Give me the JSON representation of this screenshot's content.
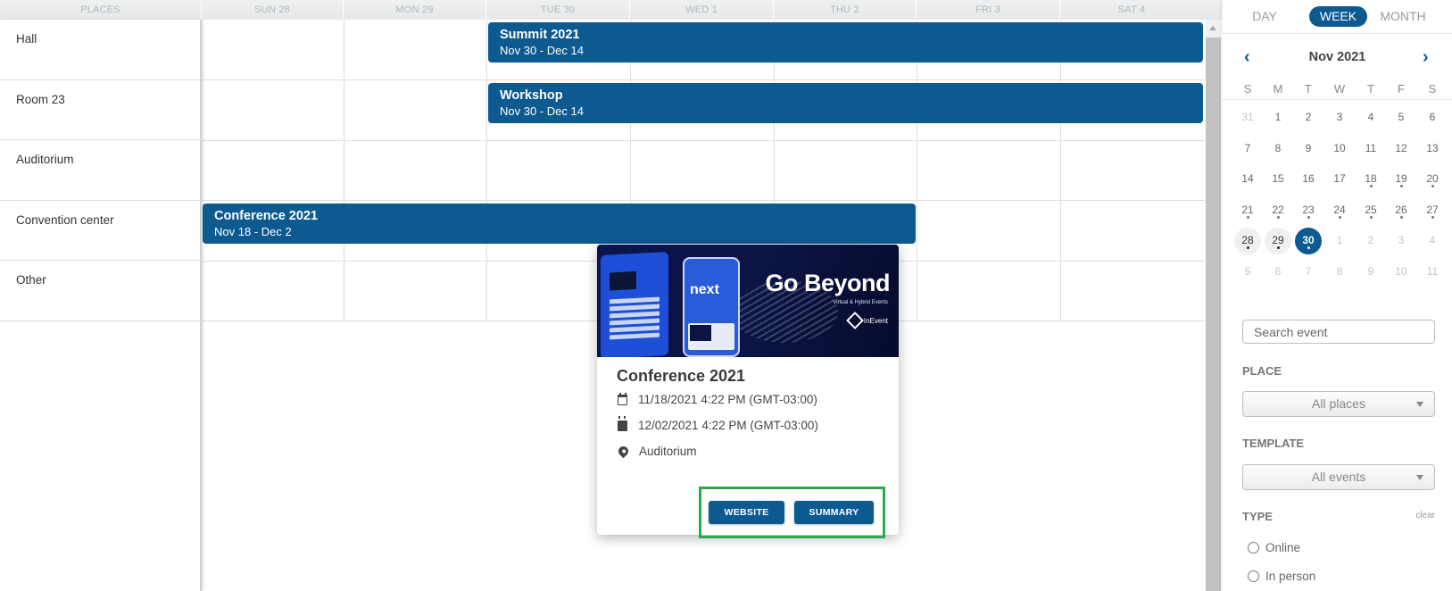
{
  "header": {
    "places_label": "PLACES",
    "days": [
      "SUN 28",
      "MON 29",
      "TUE 30",
      "WED 1",
      "THU 2",
      "FRI 3",
      "SAT 4"
    ]
  },
  "places": [
    "Hall",
    "Room 23",
    "Auditorium",
    "Convention center",
    "Other"
  ],
  "events": [
    {
      "title": "Summit 2021",
      "range": "Nov 30 - Dec 14",
      "place": "Hall"
    },
    {
      "title": "Workshop",
      "range": "Nov 30 - Dec 14",
      "place": "Room 23"
    },
    {
      "title": "Conference 2021",
      "range": "Nov 18 - Dec 2",
      "place": "Convention center"
    }
  ],
  "popover": {
    "image": {
      "headline": "Go Beyond",
      "subline": "Virtual & Hybrid Events",
      "brand": "InEvent",
      "app_text": "next"
    },
    "title": "Conference 2021",
    "start": "11/18/2021 4:22 PM (GMT-03:00)",
    "end": "12/02/2021 4:22 PM (GMT-03:00)",
    "location": "Auditorium",
    "website_label": "WEBSITE",
    "summary_label": "SUMMARY"
  },
  "sidebar": {
    "view_tabs": [
      "DAY",
      "WEEK",
      "MONTH"
    ],
    "active_view": "WEEK",
    "month_title": "Nov 2021",
    "prev_icon": "‹",
    "next_icon": "›",
    "weekdays": [
      "S",
      "M",
      "T",
      "W",
      "T",
      "F",
      "S"
    ],
    "weeks": [
      [
        {
          "d": "31",
          "m": true
        },
        {
          "d": "1"
        },
        {
          "d": "2"
        },
        {
          "d": "3"
        },
        {
          "d": "4"
        },
        {
          "d": "5"
        },
        {
          "d": "6"
        }
      ],
      [
        {
          "d": "7"
        },
        {
          "d": "8"
        },
        {
          "d": "9"
        },
        {
          "d": "10"
        },
        {
          "d": "11"
        },
        {
          "d": "12"
        },
        {
          "d": "13"
        }
      ],
      [
        {
          "d": "14"
        },
        {
          "d": "15"
        },
        {
          "d": "16"
        },
        {
          "d": "17"
        },
        {
          "d": "18",
          "dot": true
        },
        {
          "d": "19",
          "dot": true
        },
        {
          "d": "20",
          "dot": true
        }
      ],
      [
        {
          "d": "21",
          "dot": true
        },
        {
          "d": "22",
          "dot": true
        },
        {
          "d": "23",
          "dot": true
        },
        {
          "d": "24",
          "dot": true
        },
        {
          "d": "25",
          "dot": true
        },
        {
          "d": "26",
          "dot": true
        },
        {
          "d": "27",
          "dot": true
        }
      ],
      [
        {
          "d": "28",
          "dot": true,
          "w": true
        },
        {
          "d": "29",
          "dot": true,
          "w": true
        },
        {
          "d": "30",
          "dot": true,
          "sel": true
        },
        {
          "d": "1",
          "m": true
        },
        {
          "d": "2",
          "m": true
        },
        {
          "d": "3",
          "m": true
        },
        {
          "d": "4",
          "m": true
        }
      ],
      [
        {
          "d": "5",
          "m": true
        },
        {
          "d": "6",
          "m": true
        },
        {
          "d": "7",
          "m": true
        },
        {
          "d": "8",
          "m": true
        },
        {
          "d": "9",
          "m": true
        },
        {
          "d": "10",
          "m": true
        },
        {
          "d": "11",
          "m": true
        }
      ]
    ],
    "search_placeholder": "Search event",
    "place_label": "PLACE",
    "place_value": "All places",
    "template_label": "TEMPLATE",
    "template_value": "All events",
    "type_label": "TYPE",
    "clear_label": "clear",
    "type_options": [
      "Online",
      "In person"
    ]
  },
  "colors": {
    "accent": "#0d5a91",
    "highlight": "#2fa84f"
  }
}
